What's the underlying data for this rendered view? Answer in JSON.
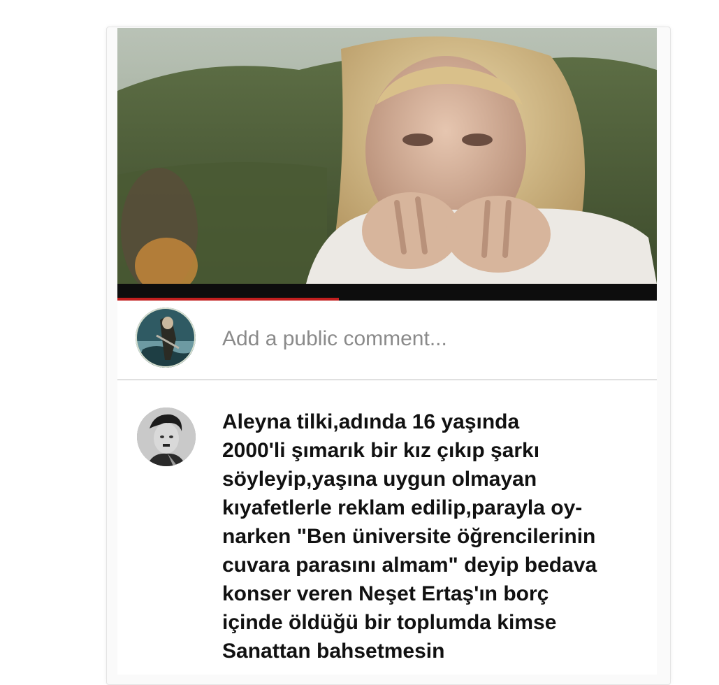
{
  "comment_box": {
    "placeholder": "Add a public comment..."
  },
  "video": {
    "progress": 0.41
  },
  "comment": {
    "text": "Aleyna tilki,adında 16 yaşında\n2000'li şımarık bir kız çıkıp şarkı\nsöyleyip,yaşına uygun olmayan\nkıyafetlerle reklam edilip,parayla oy-\nnarken \"Ben üniversite öğrencilerinin\ncuvara parasını almam\" deyip bedava\nkonser veren Neşet Ertaş'ın borç\niçinde öldüğü bir toplumda kimse\nSanattan bahsetmesin"
  },
  "colors": {
    "progress_fill": "#c21f1f",
    "player_bar": "#0d0d0d",
    "placeholder_text": "#8a8a8a"
  }
}
